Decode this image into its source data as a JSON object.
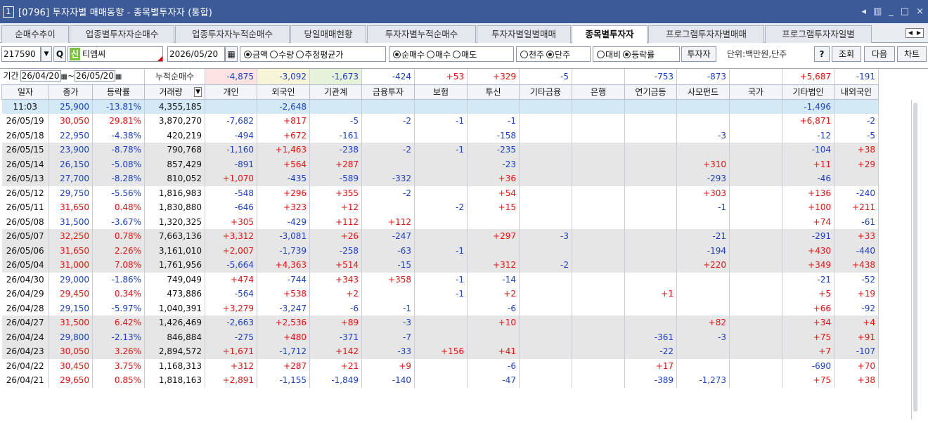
{
  "window": {
    "number": "1",
    "title": "[0796] 투자자별 매매동향 - 종목별투자자 (통합)",
    "controls": [
      "◂",
      "▥",
      "_",
      "□",
      "×"
    ]
  },
  "tabs": [
    "순매수추이",
    "업종별투자자순매수",
    "업종투자자누적순매수",
    "당일매매현황",
    "투자자별누적순매수",
    "투자자별일별매매",
    "종목별투자자",
    "프로그램투자자별매매",
    "프로그램투자자일별"
  ],
  "tab_nav": [
    "◀",
    "▶"
  ],
  "toolbar": {
    "code": "217590",
    "dropdown_icon": "▼",
    "search_icon": "Q",
    "badge": "신",
    "name": "티엠씨",
    "date": "2026/05/20",
    "calendar_icon": "▦",
    "radio_a": [
      "금액",
      "수량",
      "추정평균가"
    ],
    "radio_b": [
      "순매수",
      "매수",
      "매도"
    ],
    "radio_c": [
      "천주",
      "단주"
    ],
    "radio_d": [
      "대비",
      "등락률"
    ],
    "investor_btn": "투자자",
    "unit": "단위:백만원,단주",
    "help": "?",
    "query": "조회",
    "next": "다음",
    "chart": "차트"
  },
  "period": {
    "label": "기간",
    "from": "26/04/20",
    "sep": "~",
    "to": "26/05/20",
    "cum_label": "누적순매수",
    "cum_values": [
      "-4,875",
      "-3,092",
      "-1,673",
      "-424",
      "+53",
      "+329",
      "-5",
      "",
      "-753",
      "-873",
      "",
      "+5,687",
      "-191"
    ]
  },
  "columns": [
    "일자",
    "종가",
    "등락률",
    "거래량",
    "개인",
    "외국인",
    "기관계",
    "금융투자",
    "보험",
    "투신",
    "기타금융",
    "은행",
    "연기금등",
    "사모펀드",
    "국가",
    "기타법인",
    "내외국인"
  ],
  "sort_icon": "▼",
  "rows": [
    [
      "11:03",
      "25,900",
      "-13.81%",
      "4,355,185",
      "",
      "-2,648",
      "",
      "",
      "",
      "",
      "",
      "",
      "",
      "",
      "",
      "-1,496",
      ""
    ],
    [
      "26/05/19",
      "30,050",
      "29.81%",
      "3,870,270",
      "-7,682",
      "+817",
      "-5",
      "-2",
      "-1",
      "-1",
      "",
      "",
      "",
      "",
      "",
      "+6,871",
      "-2"
    ],
    [
      "26/05/18",
      "22,950",
      "-4.38%",
      "420,219",
      "-494",
      "+672",
      "-161",
      "",
      "",
      "-158",
      "",
      "",
      "",
      "-3",
      "",
      "-12",
      "-5"
    ],
    [
      "26/05/15",
      "23,900",
      "-8.78%",
      "790,768",
      "-1,160",
      "+1,463",
      "-238",
      "-2",
      "-1",
      "-235",
      "",
      "",
      "",
      "",
      "",
      "-104",
      "+38"
    ],
    [
      "26/05/14",
      "26,150",
      "-5.08%",
      "857,429",
      "-891",
      "+564",
      "+287",
      "",
      "",
      "-23",
      "",
      "",
      "",
      "+310",
      "",
      "+11",
      "+29"
    ],
    [
      "26/05/13",
      "27,700",
      "-8.28%",
      "810,052",
      "+1,070",
      "-435",
      "-589",
      "-332",
      "",
      "+36",
      "",
      "",
      "",
      "-293",
      "",
      "-46",
      ""
    ],
    [
      "26/05/12",
      "29,750",
      "-5.56%",
      "1,816,983",
      "-548",
      "+296",
      "+355",
      "-2",
      "",
      "+54",
      "",
      "",
      "",
      "+303",
      "",
      "+136",
      "-240"
    ],
    [
      "26/05/11",
      "31,650",
      "0.48%",
      "1,830,880",
      "-646",
      "+323",
      "+12",
      "",
      "-2",
      "+15",
      "",
      "",
      "",
      "-1",
      "",
      "+100",
      "+211"
    ],
    [
      "26/05/08",
      "31,500",
      "-3.67%",
      "1,320,325",
      "+305",
      "-429",
      "+112",
      "+112",
      "",
      "",
      "",
      "",
      "",
      "",
      "",
      "+74",
      "-61"
    ],
    [
      "26/05/07",
      "32,250",
      "0.78%",
      "7,663,136",
      "+3,312",
      "-3,081",
      "+26",
      "-247",
      "",
      "+297",
      "-3",
      "",
      "",
      "-21",
      "",
      "-291",
      "+33"
    ],
    [
      "26/05/06",
      "31,650",
      "2.26%",
      "3,161,010",
      "+2,007",
      "-1,739",
      "-258",
      "-63",
      "-1",
      "",
      "",
      "",
      "",
      "-194",
      "",
      "+430",
      "-440"
    ],
    [
      "26/05/04",
      "31,000",
      "7.08%",
      "1,761,956",
      "-5,664",
      "+4,363",
      "+514",
      "-15",
      "",
      "+312",
      "-2",
      "",
      "",
      "+220",
      "",
      "+349",
      "+438"
    ],
    [
      "26/04/30",
      "29,000",
      "-1.86%",
      "749,049",
      "+474",
      "-744",
      "+343",
      "+358",
      "-1",
      "-14",
      "",
      "",
      "",
      "",
      "",
      "-21",
      "-52"
    ],
    [
      "26/04/29",
      "29,450",
      "0.34%",
      "473,886",
      "-564",
      "+538",
      "+2",
      "",
      "-1",
      "+2",
      "",
      "",
      "+1",
      "",
      "",
      "+5",
      "+19"
    ],
    [
      "26/04/28",
      "29,150",
      "-5.97%",
      "1,040,391",
      "+3,279",
      "-3,247",
      "-6",
      "-1",
      "",
      "-6",
      "",
      "",
      "",
      "",
      "",
      "+66",
      "-92"
    ],
    [
      "26/04/27",
      "31,500",
      "6.42%",
      "1,426,469",
      "-2,663",
      "+2,536",
      "+89",
      "-3",
      "",
      "+10",
      "",
      "",
      "",
      "+82",
      "",
      "+34",
      "+4"
    ],
    [
      "26/04/24",
      "29,800",
      "-2.13%",
      "846,884",
      "-275",
      "+480",
      "-371",
      "-7",
      "",
      "",
      "",
      "",
      "-361",
      "-3",
      "",
      "+75",
      "+91"
    ],
    [
      "26/04/23",
      "30,050",
      "3.26%",
      "2,894,572",
      "+1,671",
      "-1,712",
      "+142",
      "-33",
      "+156",
      "+41",
      "",
      "",
      "-22",
      "",
      "",
      "+7",
      "-107"
    ],
    [
      "26/04/22",
      "30,450",
      "3.75%",
      "1,168,313",
      "+312",
      "+287",
      "+21",
      "+9",
      "",
      "-6",
      "",
      "",
      "+17",
      "",
      "",
      "-690",
      "+70"
    ],
    [
      "26/04/21",
      "29,650",
      "0.85%",
      "1,818,163",
      "+2,891",
      "-1,155",
      "-1,849",
      "-140",
      "",
      "-47",
      "",
      "",
      "-389",
      "-1,273",
      "",
      "+75",
      "+38"
    ]
  ],
  "gray_rows": [
    3,
    4,
    5,
    9,
    10,
    11,
    15,
    16,
    17
  ],
  "colors": {
    "title_bar": "#3d5a98",
    "positive": "#e11111",
    "negative": "#1a3fc8",
    "current_row": "#d3eaf6",
    "gray_row": "#e6e6e6"
  }
}
